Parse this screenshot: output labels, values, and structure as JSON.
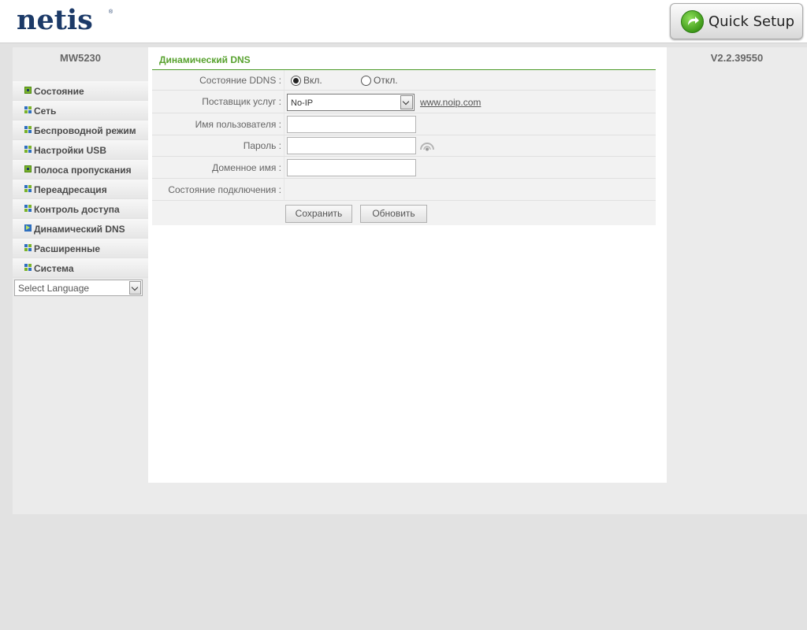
{
  "header": {
    "logo": "netis",
    "logo_mark": "®",
    "quick_setup_label": "Quick Setup"
  },
  "device": {
    "model": "MW5230",
    "firmware": "V2.2.39550"
  },
  "sidebar": {
    "items": [
      {
        "label": "Состояние",
        "icon": "plus-square-icon"
      },
      {
        "label": "Сеть",
        "icon": "grid-icon"
      },
      {
        "label": "Беспроводной режим",
        "icon": "grid-icon"
      },
      {
        "label": "Настройки USB",
        "icon": "grid-icon"
      },
      {
        "label": "Полоса пропускания",
        "icon": "plus-square-icon"
      },
      {
        "label": "Переадресация",
        "icon": "grid-icon"
      },
      {
        "label": "Контроль доступа",
        "icon": "grid-icon"
      },
      {
        "label": "Динамический DNS",
        "icon": "arrow-square-icon",
        "active": true
      },
      {
        "label": "Расширенные",
        "icon": "grid-icon"
      },
      {
        "label": "Система",
        "icon": "grid-icon"
      }
    ],
    "language_select": "Select Language"
  },
  "page": {
    "title": "Динамический DNS",
    "fields": {
      "ddns_status_label": "Состояние DDNS :",
      "ddns_on_label": "Вкл.",
      "ddns_off_label": "Откл.",
      "ddns_selected": "on",
      "provider_label": "Поставщик услуг :",
      "provider_value": "No-IP",
      "provider_link": "www.noip.com",
      "username_label": "Имя пользователя :",
      "username_value": "",
      "password_label": "Пароль :",
      "password_value": "",
      "domain_label": "Доменное имя :",
      "domain_value": "",
      "connection_status_label": "Состояние подключения :",
      "connection_status_value": ""
    },
    "buttons": {
      "save": "Сохранить",
      "refresh": "Обновить"
    }
  },
  "colors": {
    "accent_green": "#58a22f",
    "logo_navy": "#1c3a68"
  }
}
